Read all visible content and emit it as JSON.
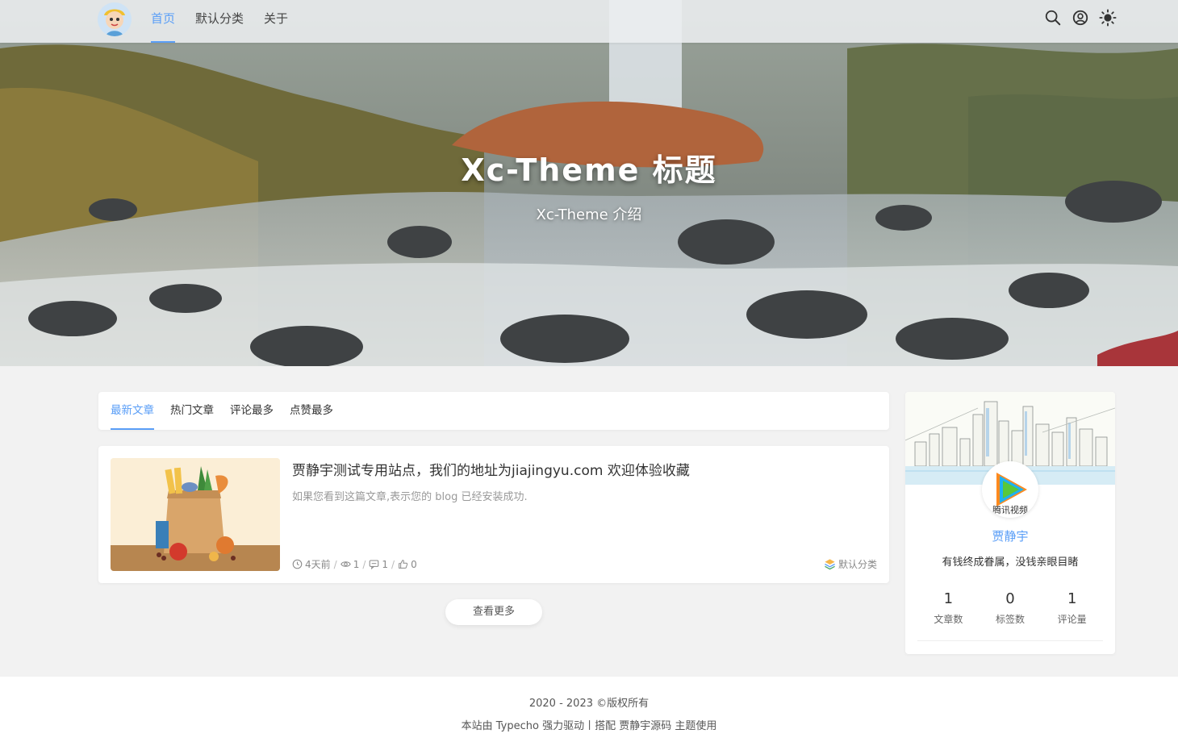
{
  "nav": {
    "items": [
      {
        "label": "首页",
        "active": true
      },
      {
        "label": "默认分类",
        "active": false
      },
      {
        "label": "关于",
        "active": false
      }
    ],
    "icons": [
      "search-icon",
      "user-circle-icon",
      "sun-icon"
    ]
  },
  "hero": {
    "title": "Xc-Theme 标题",
    "subtitle": "Xc-Theme 介绍"
  },
  "tabs": [
    {
      "label": "最新文章",
      "active": true
    },
    {
      "label": "热门文章",
      "active": false
    },
    {
      "label": "评论最多",
      "active": false
    },
    {
      "label": "点赞最多",
      "active": false
    }
  ],
  "post": {
    "title": "贾静宇测试专用站点，我们的地址为jiajingyu.com 欢迎体验收藏",
    "excerpt": "如果您看到这篇文章,表示您的 blog 已经安装成功.",
    "time": "4天前",
    "views": "1",
    "comments": "1",
    "likes": "0",
    "category": "默认分类",
    "separator": "/"
  },
  "more_label": "查看更多",
  "profile": {
    "name": "贾静宇",
    "motto": "有钱终成眷属，没钱亲眼目睹",
    "avatar_text": "腾讯视频",
    "stats": [
      {
        "num": "1",
        "label": "文章数"
      },
      {
        "num": "0",
        "label": "标签数"
      },
      {
        "num": "1",
        "label": "评论量"
      }
    ]
  },
  "footer": {
    "copyright": "2020 - 2023 ©版权所有",
    "powered_prefix": "本站由 ",
    "typecho": "Typecho",
    "powered_mid": " 强力驱动丨搭配 ",
    "theme_link": "贾静宇源码",
    "powered_suffix": " 主题使用"
  },
  "colors": {
    "accent": "#5a9ef7",
    "background": "#f2f2f2"
  }
}
